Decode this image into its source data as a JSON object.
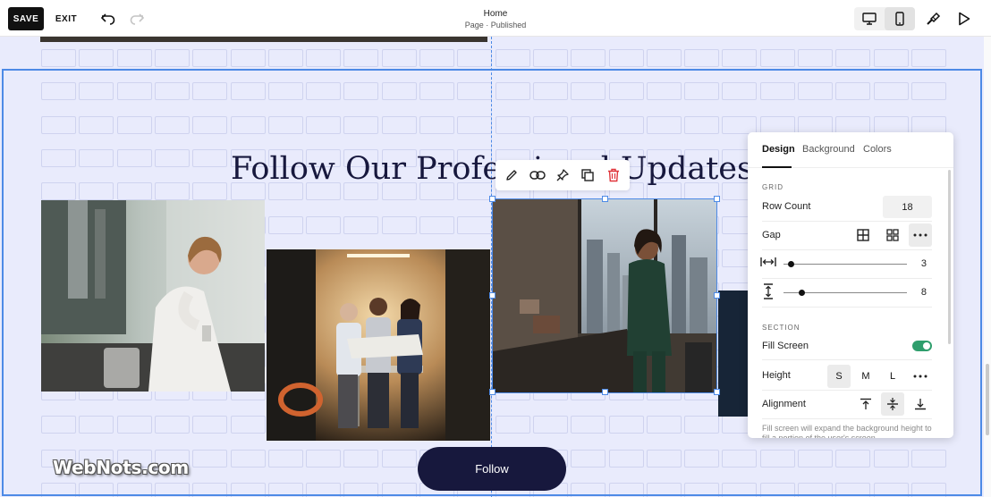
{
  "topbar": {
    "save_label": "SAVE",
    "exit_label": "EXIT",
    "page_title": "Home",
    "page_status": "Page · Published"
  },
  "icons": {
    "undo": "undo-icon",
    "redo": "redo-icon",
    "desktop": "desktop-icon",
    "mobile": "mobile-icon",
    "style": "paintbrush-icon",
    "preview": "play-icon"
  },
  "section": {
    "heading": "Follow Our Professional Updates",
    "follow_label": "Follow"
  },
  "block_toolbar": [
    "edit-icon",
    "link-icon",
    "pin-icon",
    "duplicate-icon",
    "trash-icon"
  ],
  "panel": {
    "tabs": [
      "Design",
      "Background",
      "Colors"
    ],
    "active_tab": "Design",
    "grid_label": "GRID",
    "row_count_label": "Row Count",
    "row_count_value": "18",
    "gap_label": "Gap",
    "horizontal_gap_value": "3",
    "vertical_gap_value": "8",
    "horizontal_gap_level": 0.06,
    "vertical_gap_level": 0.15,
    "section_label": "SECTION",
    "fill_screen_label": "Fill Screen",
    "fill_screen_on": true,
    "height_label": "Height",
    "height_options": [
      "S",
      "M",
      "L"
    ],
    "height_selected": "S",
    "alignment_label": "Alignment",
    "alignment_selected": "middle",
    "note": "Fill screen will expand the background height to fill a portion of the user's screen."
  },
  "watermark": "WebNots.com",
  "colors": {
    "accent": "#4d8ae6",
    "canvas": "#e9ebfc",
    "heading": "#17183d",
    "toggle_on": "#2f9e6d",
    "delete": "#e0343a"
  }
}
